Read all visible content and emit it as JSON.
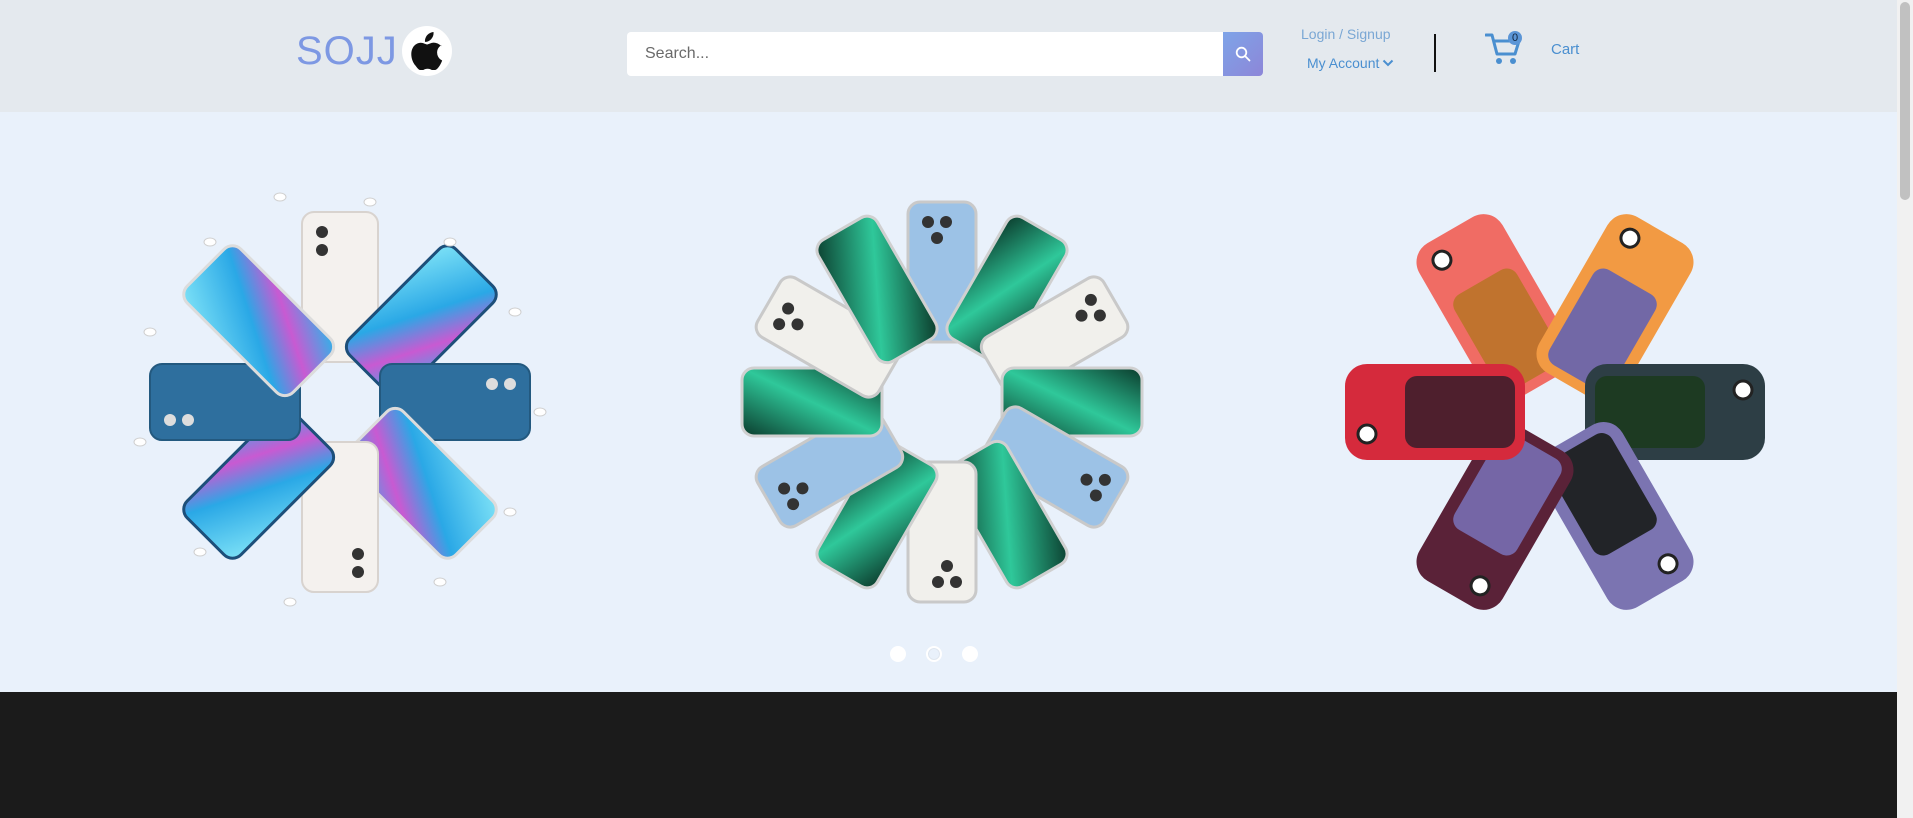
{
  "header": {
    "logo_text": "SOJJ",
    "search_placeholder": "Search...",
    "login_label": "Login / Signup",
    "account_label": "My Account",
    "cart_count": "0",
    "cart_label": "Cart"
  },
  "hero": {
    "slides": [
      {
        "icon": "iphone-13-fan-with-airpods-image"
      },
      {
        "icon": "iphone-13-pro-circle-image"
      },
      {
        "icon": "iphone-magsafe-cases-image"
      }
    ],
    "dots": 3,
    "active_dot": 2
  },
  "colors": {
    "brand": "#7d98e3",
    "header_bg": "#e4e9ee",
    "hero_bg": "#e9f1fb",
    "link": "#4a8fd0",
    "footer_bg": "#1b1b1b"
  }
}
